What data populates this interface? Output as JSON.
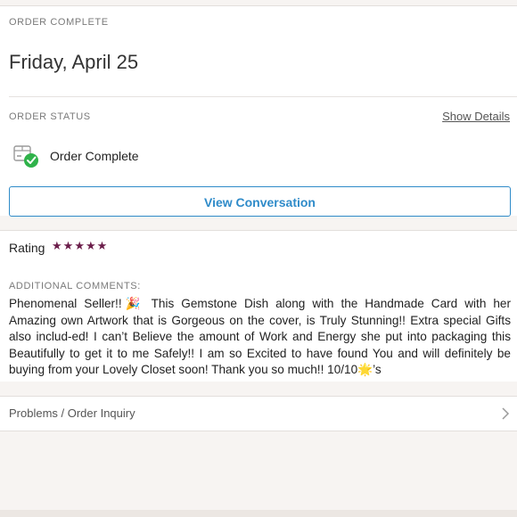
{
  "order": {
    "complete_label": "ORDER COMPLETE",
    "date": "Friday, April 25",
    "status_label": "ORDER STATUS",
    "show_details": "Show Details",
    "status_text": "Order Complete",
    "view_conversation": "View Conversation"
  },
  "rating": {
    "label": "Rating",
    "stars": 5,
    "star_glyph": "★",
    "star_color": "#6b1d4a",
    "comments_label": "ADDITIONAL COMMENTS:",
    "comment_parts": [
      "Phenomenal Seller!!",
      "🎉",
      " This Gemstone Dish along with the Handmade Card with her Amazing own Artwork that is Gorgeous on the cover, is Truly Stunning!! Extra special Gifts also includ-ed! I can’t Believe the amount of Work and Energy she put into packaging this Beautifully to get it to me Safely!! I am so Excited to have found You and will definitely be buying from your Lovely Closet soon! Thank you so much!! 10/10",
      "🌟",
      "’s"
    ]
  },
  "inquiry": {
    "label": "Problems / Order Inquiry"
  },
  "colors": {
    "accent": "#2f8bc9",
    "success": "#2fb24a",
    "background": "#f7f4f2"
  },
  "icons": {
    "status": "package-check-icon",
    "chevron": "chevron-right-icon"
  }
}
